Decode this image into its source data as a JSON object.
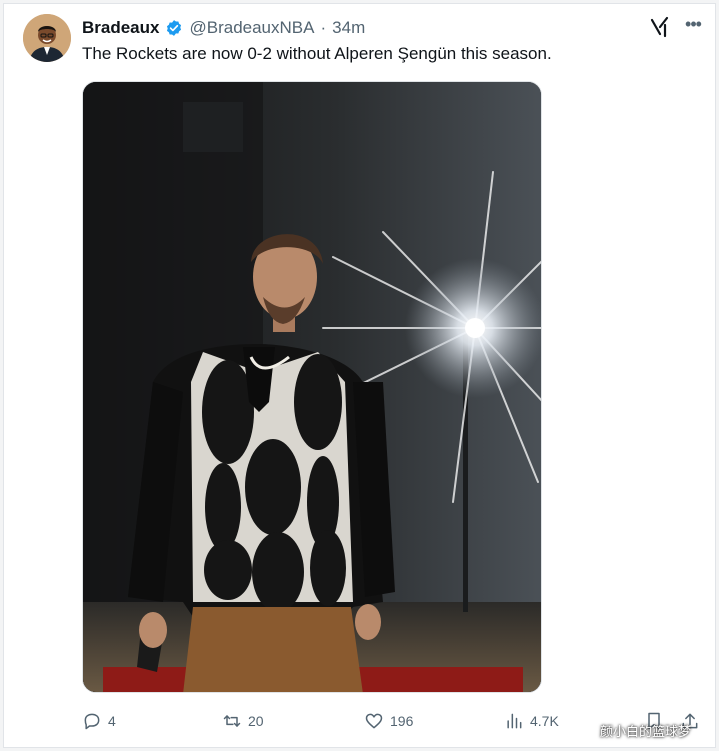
{
  "tweet": {
    "display_name": "Bradeaux",
    "handle": "@BradeauxNBA",
    "separator": "·",
    "time": "34m",
    "text": "The Rockets are now 0-2 without Alperen Şengün this season.",
    "verified_color": "#1d9bf0"
  },
  "actions": {
    "replies": "4",
    "retweets": "20",
    "likes": "196",
    "views": "4.7K"
  },
  "icons": {
    "verified": "verified-badge-icon",
    "grok": "grok-icon",
    "more": "more-icon",
    "reply": "reply-icon",
    "retweet": "retweet-icon",
    "like": "heart-icon",
    "views": "views-icon",
    "bookmark": "bookmark-icon",
    "share": "share-icon"
  },
  "watermark": "颜小白的篮球梦"
}
